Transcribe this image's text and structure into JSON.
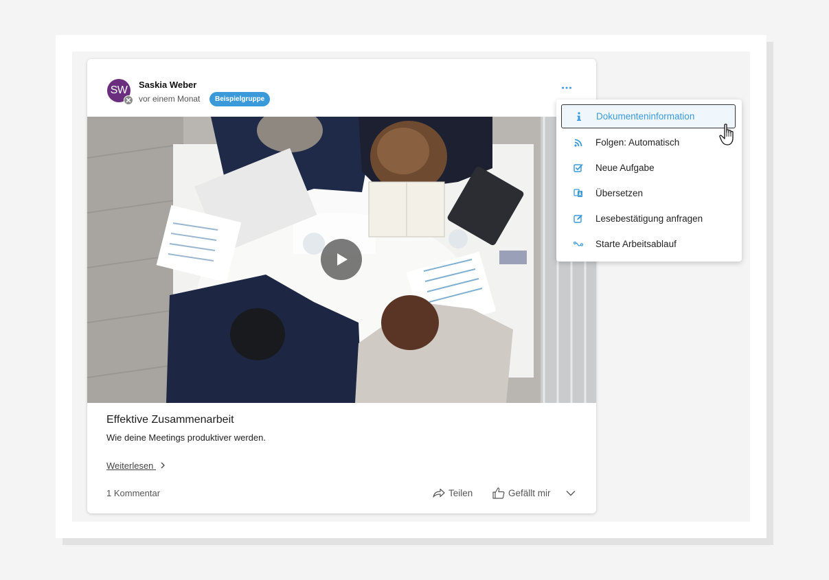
{
  "post": {
    "author": "Saskia Weber",
    "avatar_initials": "SW",
    "time": "vor einem Monat",
    "group": "Beispielgruppe",
    "title": "Effektive Zusammenarbeit",
    "excerpt": "Wie deine Meetings produktiver werden.",
    "read_more": "Weiterlesen",
    "comments": "1 Kommentar",
    "share_label": "Teilen",
    "like_label": "Gefällt mir"
  },
  "menu": {
    "items": [
      {
        "label": "Dokumenteninformation",
        "icon": "info-icon"
      },
      {
        "label": "Folgen: Automatisch",
        "icon": "rss-icon"
      },
      {
        "label": "Neue Aufgabe",
        "icon": "task-checkbox-icon"
      },
      {
        "label": "Übersetzen",
        "icon": "translate-icon"
      },
      {
        "label": "Lesebestätigung anfragen",
        "icon": "edit-icon"
      },
      {
        "label": "Starte Arbeitsablauf",
        "icon": "workflow-icon"
      }
    ]
  },
  "colors": {
    "accent": "#3a9ad9",
    "avatar": "#6b2d7e",
    "suit": "#1f2a48"
  }
}
